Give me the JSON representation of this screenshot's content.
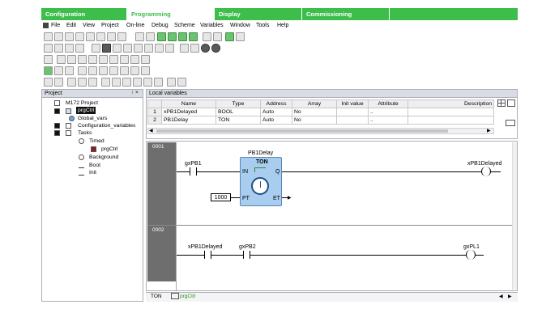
{
  "main_tabs": [
    {
      "label": "Configuration"
    },
    {
      "label": "Programming"
    },
    {
      "label": "Display"
    },
    {
      "label": "Commissioning"
    }
  ],
  "menu": [
    "File",
    "Edit",
    "View",
    "Project",
    "On-line",
    "Debug",
    "Scheme",
    "Variables",
    "Window",
    "Tools",
    "Help"
  ],
  "project_panel": {
    "title": "Project",
    "pin": "↑ ×",
    "tree": {
      "root": "M172 Project",
      "prgctrl": "prgCtrl",
      "global_vars": "Global_vars",
      "config_vars": "Configuration_variables",
      "tasks": "Tasks",
      "timed": "Timed",
      "timed_prg": "prgCtrl",
      "background": "Background",
      "boot": "Boot",
      "init": "Init"
    }
  },
  "local_vars": {
    "title": "Local variables",
    "columns": [
      "",
      "Name",
      "Type",
      "Address",
      "Array",
      "Init value",
      "Attribute",
      "Description"
    ],
    "rows": [
      [
        "1",
        "xPB1Delayed",
        "BOOL",
        "Auto",
        "No",
        "",
        "..",
        ""
      ],
      [
        "2",
        "PB1Delay",
        "TON",
        "Auto",
        "No",
        "",
        "..",
        ""
      ]
    ]
  },
  "ladder": {
    "rung1": {
      "number": "0001",
      "contact_label": "gxPB1",
      "fb_instance": "PB1Delay",
      "fb_type": "TON",
      "in_pin": "IN",
      "q_pin": "Q",
      "pt_pin": "PT",
      "et_pin": "ET",
      "pt_value": "1000",
      "coil_label": "xPB1Delayed"
    },
    "rung2": {
      "number": "0002",
      "contact1_label": "xPB1Delayed",
      "contact2_label": "gxPB2",
      "coil_label": "gxPL1"
    }
  },
  "bottom_tabs": [
    {
      "label": "TON"
    },
    {
      "label": "prgCtrl"
    }
  ],
  "colors": {
    "tab_green": "#3dbe4b",
    "tab_active": "#ffffff",
    "tab_active_text": "#3dbe4b",
    "fb_fill": "#a8cdee",
    "rung_gutter": "#6e6e6e"
  }
}
